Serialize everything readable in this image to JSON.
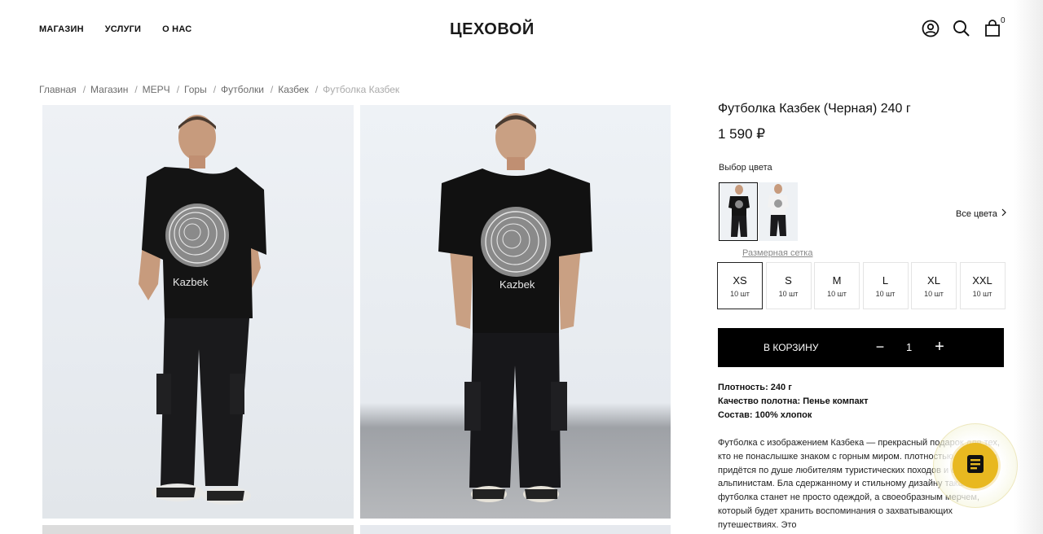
{
  "header": {
    "nav": [
      {
        "label": "МАГАЗИН"
      },
      {
        "label": "УСЛУГИ"
      },
      {
        "label": "О НАС"
      }
    ],
    "logo": "ЦЕХОВОЙ",
    "cart_count": "0",
    "icons": [
      "user-icon",
      "search-icon",
      "cart-icon"
    ]
  },
  "breadcrumb": [
    {
      "label": "Главная"
    },
    {
      "label": "Магазин"
    },
    {
      "label": "МЕРЧ"
    },
    {
      "label": "Горы"
    },
    {
      "label": "Футболки"
    },
    {
      "label": "Казбек"
    },
    {
      "label": "Футболка Казбек"
    }
  ],
  "product": {
    "title": "Футболка Казбек (Черная) 240 г",
    "price": "1 590 ₽",
    "color_label": "Выбор цвета",
    "all_colors": "Все цвета",
    "size_chart": "Размерная сетка",
    "sizes": [
      {
        "name": "XS",
        "qty": "10 шт"
      },
      {
        "name": "S",
        "qty": "10 шт"
      },
      {
        "name": "M",
        "qty": "10 шт"
      },
      {
        "name": "L",
        "qty": "10 шт"
      },
      {
        "name": "XL",
        "qty": "10 шт"
      },
      {
        "name": "XXL",
        "qty": "10 шт"
      }
    ],
    "selected_size": "XS",
    "buy_label": "В КОРЗИНУ",
    "quantity": "1",
    "specs": [
      "Плотность: 240 г",
      "Качество полотна: Пенье компакт",
      "Состав: 100% хлопок"
    ],
    "description": "Футболка с изображением Казбека — прекрасный подарок для тех, кто не понаслышке знаком с горным миром. плотностью 240 г. Она придётся по душе любителям туристических походов и опытным альпинистам. Бла сдержанному и стильному дизайну такая футболка станет не просто одеждой, а своеобразным мерчем, который будет хранить воспоминания о захватывающих путешествиях. Это",
    "print_text": "Kazbek"
  },
  "colors": {
    "accent": "#e8b820",
    "button_bg": "#000000",
    "tshirt": "#141414",
    "tshirt_white": "#f2f2f2"
  }
}
